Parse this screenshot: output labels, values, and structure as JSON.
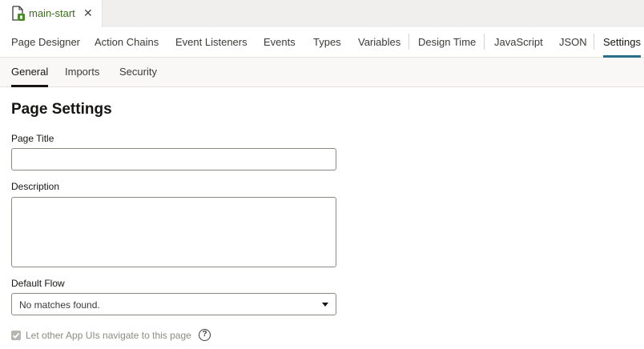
{
  "file_tab": {
    "name": "main-start",
    "close_glyph": "✕",
    "icon": "page-file-icon"
  },
  "main_tabs": [
    {
      "label": "Page Designer"
    },
    {
      "label": "Action Chains"
    },
    {
      "label": "Event Listeners"
    },
    {
      "label": "Events"
    },
    {
      "label": "Types"
    },
    {
      "label": "Variables"
    },
    {
      "label": "Design Time"
    },
    {
      "label": "JavaScript"
    },
    {
      "label": "JSON"
    },
    {
      "label": "Settings",
      "active": true
    }
  ],
  "sub_tabs": [
    {
      "label": "General",
      "active": true
    },
    {
      "label": "Imports"
    },
    {
      "label": "Security"
    }
  ],
  "settings": {
    "heading": "Page Settings",
    "page_title_label": "Page Title",
    "page_title_value": "",
    "description_label": "Description",
    "description_value": "",
    "default_flow_label": "Default Flow",
    "default_flow_value": "No matches found.",
    "navigate_checkbox_label": "Let other App UIs navigate to this page",
    "navigate_checked": true,
    "help_glyph": "?"
  },
  "colors": {
    "active_tab_underline": "#28708a",
    "file_name": "#3a6e1a"
  }
}
